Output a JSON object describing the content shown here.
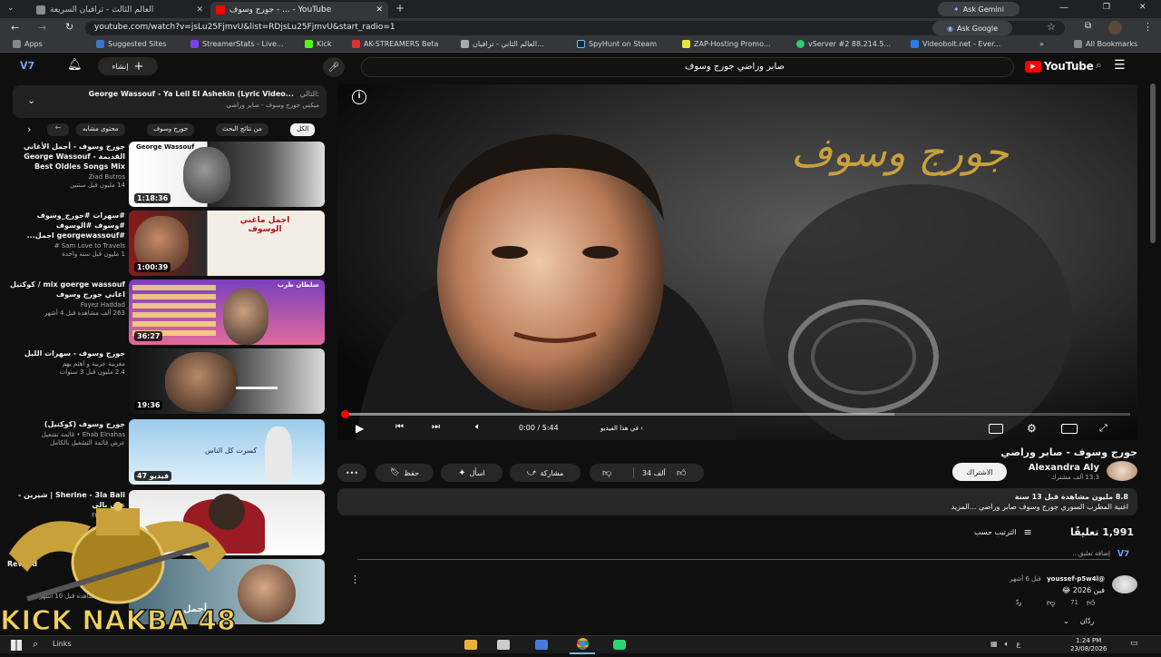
{
  "browser": {
    "tabs": [
      {
        "label": "العالم الثالث - ترافيان السريعة",
        "active": false
      },
      {
        "label": "جورج وسوف - ... - YouTube",
        "active": true
      }
    ],
    "new_tab": "+",
    "ask_gemini": "Ask Gemini",
    "url": "youtube.com/watch?v=jsLu25FjmvU&list=RDjsLu25FjmvU&start_radio=1",
    "ask_google": "Ask Google",
    "bookmarks": [
      "Apps",
      "Suggested Sites",
      "StreamerStats - Live...",
      "Kick",
      "AK-STREAMERS Beta",
      "العالم الثاني - ترافيان...",
      "SpyHunt on Steam",
      "ZAP-Hosting Promo...",
      "vServer #2 88.214.5...",
      "Videobolt.net - Ever...",
      "All Bookmarks"
    ],
    "bookmarks_more": "»"
  },
  "header": {
    "logo": "YouTube",
    "logo_sup": "JO",
    "search_value": "صابر وراضي جورج وسوف",
    "create_label": "إنشاء"
  },
  "queue": {
    "title": "George Wassouf - Ya Leil El Ashekin (Lyric Video...",
    "prefix": "التالي:",
    "subtitle": "ميكس جورج وسوف - صابر وراضي"
  },
  "chips": [
    "الكل",
    "من نتائج البحث",
    "جورج وسوف",
    "محتوى مشابه"
  ],
  "recommendations": [
    {
      "title": "جورج وسوف - أجمل الأغاني القديمة George Wassouf - Best Oldies Songs Mix",
      "channel": "Ziad Butros",
      "views": "14 مليون  قبل سنتين",
      "duration": "1:18:36",
      "thumb_text": "George Wassouf"
    },
    {
      "title": "#سهرات #جورج_وسوف #وسوف #الوسوف #georgewassouf اجمل...",
      "channel": "Sam Love to Travels #",
      "views": "1 مليون  قبل سنة واحدة",
      "duration": "1:00:39",
      "thumb_text": "اجمل ماغني الوسوف"
    },
    {
      "title": "mix goerge wassouf / كوكتيل اغاني جورج وسوف",
      "channel": "Fayez Haddad",
      "views": "263 ألف  مشاهدة  قبل 4 أشهر",
      "duration": "36:27",
      "thumb_text": "سلطان طرب"
    },
    {
      "title": "جورج وسوف - سهرات الليل",
      "channel": "مغربية عربية و اهتم بهم",
      "views": "2.4 مليون  قبل 3 سنوات",
      "duration": "19:36",
      "thumb_text": ""
    },
    {
      "title": "جورج وسوف (كوكتيل)",
      "channel": "Ehab Elnahas • قائمة تشغيل",
      "views": "عرض قائمة التشغيل بالكامل",
      "duration": "47 فيديو",
      "thumb_text": "كسرت كل الناس"
    },
    {
      "title": "Sherine - 3la Bali | شيرين - على بالي",
      "channel": "Free Music",
      "views": "",
      "duration": "",
      "thumb_text": ""
    },
    {
      "title": "Rewind",
      "channel": "",
      "views": "10 مليون  مشاهدة  قبل 10 أشهر",
      "duration": "",
      "thumb_text": "أجمل"
    }
  ],
  "player": {
    "overlay_title": "جورج وسوف",
    "time": "0:00 / 5:44",
    "chapter": "في هذا الفيديو",
    "progress_fraction": 0.0
  },
  "video": {
    "title": "جورج وسوف - صابر وراضي",
    "channel": "Alexandra Aly",
    "subscribers": "13.3 ألف مشترك",
    "subscribe": "الاشتراك",
    "likes": "34 ألف",
    "share": "مشاركة",
    "ask": "اسأل",
    "save": "حفظ",
    "more": "•••"
  },
  "description": {
    "stats": "8.8 مليون مشاهدة  قبل 13 سنة",
    "text": "اغنية المطرب السوري جورج وسوف صابر وراضي ...المزيد"
  },
  "comments": {
    "count": "1,991 تعليقًا",
    "sort": "الترتيب حسب",
    "add": "إضافة تعليق...",
    "first": {
      "author": "@youssef-p5w4l",
      "time": "قبل 6 أشهر",
      "text": "فين 2026 😂",
      "likes": "71",
      "reply": "ردّ",
      "replies": "ردّان"
    }
  },
  "taskbar": {
    "links": "Links",
    "time": "1:24 PM",
    "date": "23/08/2026",
    "lang": "ع"
  },
  "watermark": {
    "text": "KICK NAKBA 48"
  },
  "colors": {
    "accent": "#ff0000",
    "bg": "#0f0f0f",
    "gold": "#c9a13b"
  }
}
